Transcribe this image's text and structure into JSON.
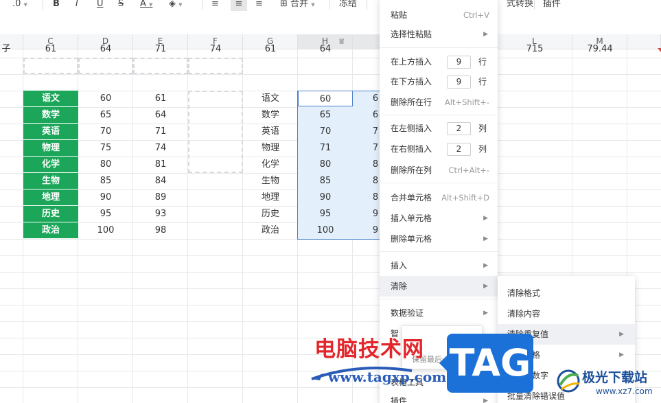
{
  "toolbar": {
    "font_size": ".0",
    "bold": "B",
    "italic": "I",
    "underline": "U",
    "strike": "S",
    "font_color": "A",
    "merge": "合并",
    "freeze": "冻结",
    "convert": "式转换",
    "plugin": "插件"
  },
  "columns": [
    {
      "id": "C",
      "label": "C"
    },
    {
      "id": "D",
      "label": "D"
    },
    {
      "id": "E",
      "label": "E"
    },
    {
      "id": "F",
      "label": "F"
    },
    {
      "id": "G",
      "label": "G"
    },
    {
      "id": "H",
      "label": "H"
    },
    {
      "id": "L",
      "label": "L"
    },
    {
      "id": "M",
      "label": "M"
    }
  ],
  "top_row": {
    "b": "子",
    "c": "61",
    "d": "64",
    "e": "71",
    "f": "74",
    "g": "61",
    "h": "64",
    "l": "715",
    "m": "79.44"
  },
  "table_left": [
    {
      "subject": "语文",
      "d": "60",
      "e": "61"
    },
    {
      "subject": "数学",
      "d": "65",
      "e": "64"
    },
    {
      "subject": "英语",
      "d": "70",
      "e": "71"
    },
    {
      "subject": "物理",
      "d": "75",
      "e": "74"
    },
    {
      "subject": "化学",
      "d": "80",
      "e": "81"
    },
    {
      "subject": "生物",
      "d": "85",
      "e": "84"
    },
    {
      "subject": "地理",
      "d": "90",
      "e": "89"
    },
    {
      "subject": "历史",
      "d": "95",
      "e": "93"
    },
    {
      "subject": "政治",
      "d": "100",
      "e": "98"
    }
  ],
  "table_right": [
    {
      "subject": "语文",
      "h": "60",
      "i": "6"
    },
    {
      "subject": "数学",
      "h": "65",
      "i": "6"
    },
    {
      "subject": "英语",
      "h": "70",
      "i": "7"
    },
    {
      "subject": "物理",
      "h": "71",
      "i": "7"
    },
    {
      "subject": "化学",
      "h": "80",
      "i": "8"
    },
    {
      "subject": "生物",
      "h": "85",
      "i": "8"
    },
    {
      "subject": "地理",
      "h": "90",
      "i": "8"
    },
    {
      "subject": "历史",
      "h": "95",
      "i": "9"
    },
    {
      "subject": "政治",
      "h": "100",
      "i": "9"
    }
  ],
  "context_menu": {
    "paste": {
      "label": "粘贴",
      "shortcut": "Ctrl+V"
    },
    "paste_special": {
      "label": "选择性粘贴"
    },
    "insert_above": {
      "label": "在上方插入",
      "count": "9",
      "unit": "行"
    },
    "insert_below": {
      "label": "在下方插入",
      "count": "9",
      "unit": "行"
    },
    "delete_row": {
      "label": "删除所在行",
      "shortcut": "Alt+Shift+-"
    },
    "insert_left": {
      "label": "在左侧插入",
      "count": "2",
      "unit": "列"
    },
    "insert_right": {
      "label": "在右侧插入",
      "count": "2",
      "unit": "列"
    },
    "delete_col": {
      "label": "删除所在列",
      "shortcut": "Ctrl+Alt+-"
    },
    "merge_cells": {
      "label": "合并单元格",
      "shortcut": "Alt+Shift+D"
    },
    "insert_cells": {
      "label": "插入单元格"
    },
    "delete_cells": {
      "label": "删除单元格"
    },
    "insert": {
      "label": "插入"
    },
    "clear": {
      "label": "清除"
    },
    "data_validation": {
      "label": "数据验证"
    },
    "smart": {
      "label": "智"
    },
    "tools": {
      "label": "表格工具"
    },
    "plugin": {
      "label": "插件"
    }
  },
  "submenu": {
    "items": [
      {
        "label": "清除格式"
      },
      {
        "label": "清除内容"
      },
      {
        "label": "清除重复值"
      },
      {
        "label": "清除空格"
      },
      {
        "label": "清除非数字"
      },
      {
        "label": "批量清除错误值"
      }
    ]
  },
  "tooltip": {
    "text": "保留最后一次出现值"
  },
  "watermarks": {
    "site_cn": "电脑技术网",
    "site_url": "www.tagxp.com",
    "tag": "TAG",
    "jg_name": "极光下载站",
    "jg_url": "www.xz7.com"
  },
  "colors": {
    "subject_green": "#1ca65a",
    "selection_fill": "#e3effb",
    "selection_border": "#4a7fcc",
    "watermark_red": "#e2262b",
    "watermark_blue": "#2a5bb8"
  }
}
